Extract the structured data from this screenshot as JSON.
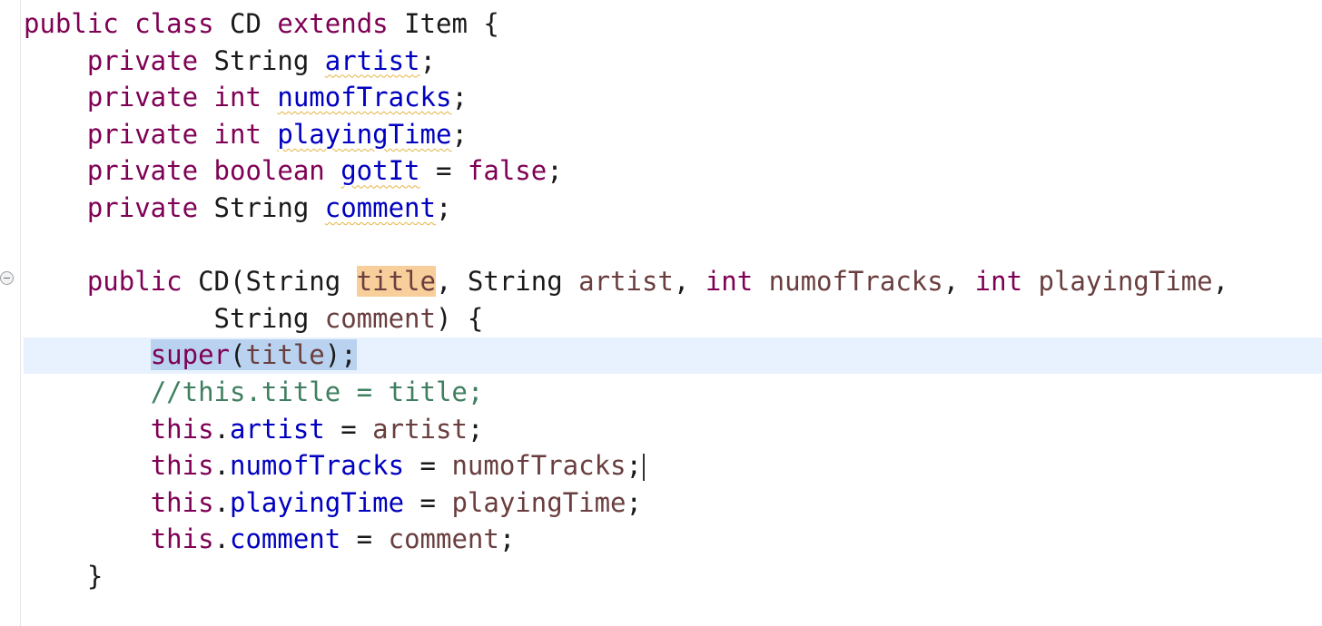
{
  "editor": {
    "lines": [
      {
        "indent": "",
        "tokens": [
          {
            "t": "public",
            "c": "kw"
          },
          {
            "t": " "
          },
          {
            "t": "class",
            "c": "kw"
          },
          {
            "t": " CD "
          },
          {
            "t": "extends",
            "c": "kw"
          },
          {
            "t": " Item {"
          }
        ]
      },
      {
        "indent": "    ",
        "tokens": [
          {
            "t": "private",
            "c": "kw"
          },
          {
            "t": " String "
          },
          {
            "t": "artist",
            "c": "field sq"
          },
          {
            "t": ";"
          }
        ]
      },
      {
        "indent": "    ",
        "tokens": [
          {
            "t": "private",
            "c": "kw"
          },
          {
            "t": " "
          },
          {
            "t": "int",
            "c": "kw"
          },
          {
            "t": " "
          },
          {
            "t": "numofTracks",
            "c": "field sq"
          },
          {
            "t": ";"
          }
        ]
      },
      {
        "indent": "    ",
        "tokens": [
          {
            "t": "private",
            "c": "kw"
          },
          {
            "t": " "
          },
          {
            "t": "int",
            "c": "kw"
          },
          {
            "t": " "
          },
          {
            "t": "playingTime",
            "c": "field sq"
          },
          {
            "t": ";"
          }
        ]
      },
      {
        "indent": "    ",
        "tokens": [
          {
            "t": "private",
            "c": "kw"
          },
          {
            "t": " "
          },
          {
            "t": "boolean",
            "c": "kw"
          },
          {
            "t": " "
          },
          {
            "t": "gotIt",
            "c": "field sq"
          },
          {
            "t": " = "
          },
          {
            "t": "false",
            "c": "kw"
          },
          {
            "t": ";"
          }
        ]
      },
      {
        "indent": "    ",
        "tokens": [
          {
            "t": "private",
            "c": "kw"
          },
          {
            "t": " String "
          },
          {
            "t": "comment",
            "c": "field sq"
          },
          {
            "t": ";"
          }
        ]
      },
      {
        "indent": "",
        "tokens": []
      },
      {
        "indent": "    ",
        "tokens": [
          {
            "t": "public",
            "c": "kw"
          },
          {
            "t": " CD(String "
          },
          {
            "t": "title",
            "c": "param occ"
          },
          {
            "t": ", String "
          },
          {
            "t": "artist",
            "c": "param"
          },
          {
            "t": ", "
          },
          {
            "t": "int",
            "c": "kw"
          },
          {
            "t": " "
          },
          {
            "t": "numofTracks",
            "c": "param"
          },
          {
            "t": ", "
          },
          {
            "t": "int",
            "c": "kw"
          },
          {
            "t": " "
          },
          {
            "t": "playingTime",
            "c": "param"
          },
          {
            "t": ","
          }
        ]
      },
      {
        "indent": "            ",
        "tokens": [
          {
            "t": "String "
          },
          {
            "t": "comment",
            "c": "param"
          },
          {
            "t": ") {"
          }
        ]
      },
      {
        "indent": "        ",
        "tokens": [
          {
            "t": "super",
            "c": "kw sel"
          },
          {
            "t": "(",
            "c": "sel"
          },
          {
            "t": "title",
            "c": "param sel"
          },
          {
            "t": ");",
            "c": "sel"
          }
        ]
      },
      {
        "indent": "        ",
        "tokens": [
          {
            "t": "//this.title = title;",
            "c": "comment"
          }
        ]
      },
      {
        "indent": "        ",
        "tokens": [
          {
            "t": "this",
            "c": "kw"
          },
          {
            "t": "."
          },
          {
            "t": "artist",
            "c": "field"
          },
          {
            "t": " = "
          },
          {
            "t": "artist",
            "c": "param"
          },
          {
            "t": ";"
          }
        ]
      },
      {
        "indent": "        ",
        "tokens": [
          {
            "t": "this",
            "c": "kw"
          },
          {
            "t": "."
          },
          {
            "t": "numofTracks",
            "c": "field"
          },
          {
            "t": " = "
          },
          {
            "t": "numofTracks",
            "c": "param"
          },
          {
            "t": ";"
          }
        ],
        "caret": true
      },
      {
        "indent": "        ",
        "tokens": [
          {
            "t": "this",
            "c": "kw"
          },
          {
            "t": "."
          },
          {
            "t": "playingTime",
            "c": "field"
          },
          {
            "t": " = "
          },
          {
            "t": "playingTime",
            "c": "param"
          },
          {
            "t": ";"
          }
        ]
      },
      {
        "indent": "        ",
        "tokens": [
          {
            "t": "this",
            "c": "kw"
          },
          {
            "t": "."
          },
          {
            "t": "comment",
            "c": "field"
          },
          {
            "t": " = "
          },
          {
            "t": "comment",
            "c": "param"
          },
          {
            "t": ";"
          }
        ]
      },
      {
        "indent": "    ",
        "tokens": [
          {
            "t": "}"
          }
        ]
      }
    ]
  }
}
